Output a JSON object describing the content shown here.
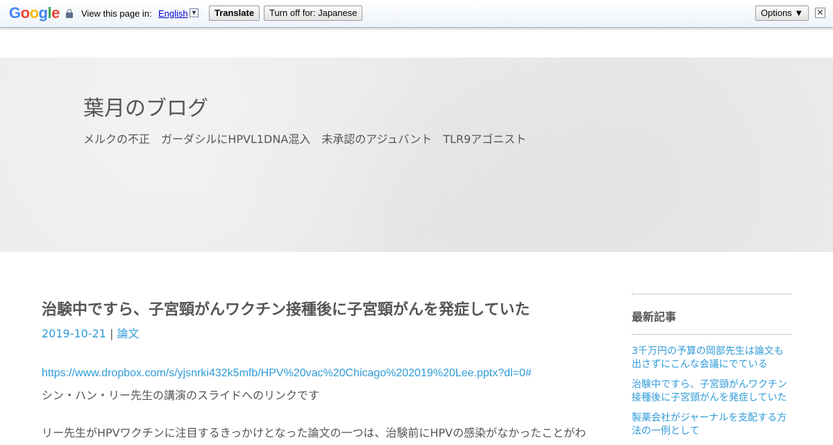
{
  "translate_bar": {
    "logo_letters": [
      {
        "ch": "G",
        "color": "#4285f4"
      },
      {
        "ch": "o",
        "color": "#ea4335"
      },
      {
        "ch": "o",
        "color": "#fbbc05"
      },
      {
        "ch": "g",
        "color": "#4285f4"
      },
      {
        "ch": "l",
        "color": "#34a853"
      },
      {
        "ch": "e",
        "color": "#ea4335"
      }
    ],
    "view_text": "View this page in:",
    "language": "English",
    "translate_label": "Translate",
    "turn_off_label": "Turn off for: Japanese",
    "options_label": "Options ▼",
    "close_glyph": "✕",
    "dropdown_glyph": "▼"
  },
  "header": {
    "title": "葉月のブログ",
    "description": "メルクの不正　ガーダシルにHPVL1DNA混入　未承認のアジュバント　TLR9アゴニスト"
  },
  "post": {
    "title": "治験中ですら、子宮頸がんワクチン接種後に子宮頸がんを発症していた",
    "date": "2019-10-21",
    "separator": " | ",
    "category": "論文",
    "link": "https://www.dropbox.com/s/yjsnrki432k5mfb/HPV%20vac%20Chicago%202019%20Lee.pptx?dl=0#",
    "paragraph1": "シン・ハン・リー先生の講演のスライドへのリンクです",
    "paragraph2": "リー先生がHPVワクチンに注目するきっかけとなった論文の一つは、治験前にHPVの感染がなかったことがわ"
  },
  "sidebar": {
    "heading": "最新記事",
    "items": [
      {
        "label": "3千万円の予算の岡部先生は論文も出さずにこんな会議にでている"
      },
      {
        "label": "治験中ですら、子宮頸がんワクチン接種後に子宮頸がんを発症していた"
      },
      {
        "label": "製薬会社がジャーナルを支配する方法の一例として"
      }
    ]
  },
  "colors": {
    "link": "#2f9bd8",
    "text": "#555555",
    "banner": "#ececec"
  }
}
